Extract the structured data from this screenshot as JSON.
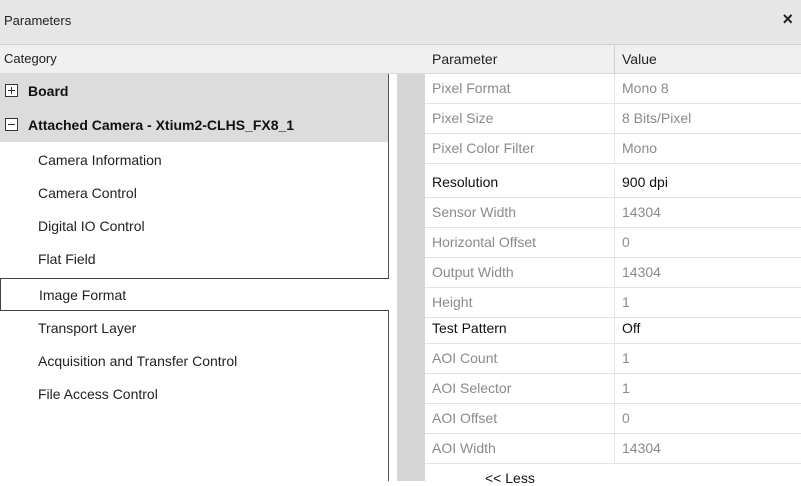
{
  "window": {
    "title": "Parameters",
    "close_glyph": "×"
  },
  "header": {
    "category": "Category",
    "parameter": "Parameter",
    "value": "Value"
  },
  "tree": {
    "groups": [
      {
        "label": "Board",
        "expanded": false
      },
      {
        "label": "Attached Camera - Xtium2-CLHS_FX8_1",
        "expanded": true
      }
    ],
    "items": [
      "Camera Information",
      "Camera Control",
      "Digital IO Control",
      "Flat Field",
      "Image Format",
      "Transport Layer",
      "Acquisition and Transfer Control",
      "File Access Control"
    ],
    "selected": "Image Format"
  },
  "params": [
    {
      "name": "Pixel Format",
      "value": "Mono 8",
      "editable": false
    },
    {
      "name": "Pixel Size",
      "value": "8 Bits/Pixel",
      "editable": false
    },
    {
      "name": "Pixel Color Filter",
      "value": "Mono",
      "editable": false
    },
    {
      "name": "Resolution",
      "value": "900 dpi",
      "editable": true
    },
    {
      "name": "Sensor Width",
      "value": "14304",
      "editable": false
    },
    {
      "name": "Horizontal Offset",
      "value": "0",
      "editable": false
    },
    {
      "name": "Output Width",
      "value": "14304",
      "editable": false
    },
    {
      "name": "Height",
      "value": "1",
      "editable": false
    },
    {
      "name": "Test Pattern",
      "value": "Off",
      "editable": true
    },
    {
      "name": "AOI Count",
      "value": "1",
      "editable": false
    },
    {
      "name": "AOI Selector",
      "value": "1",
      "editable": false
    },
    {
      "name": "AOI Offset",
      "value": "0",
      "editable": false
    },
    {
      "name": "AOI Width",
      "value": "14304",
      "editable": false
    }
  ],
  "less_label": "<< Less"
}
